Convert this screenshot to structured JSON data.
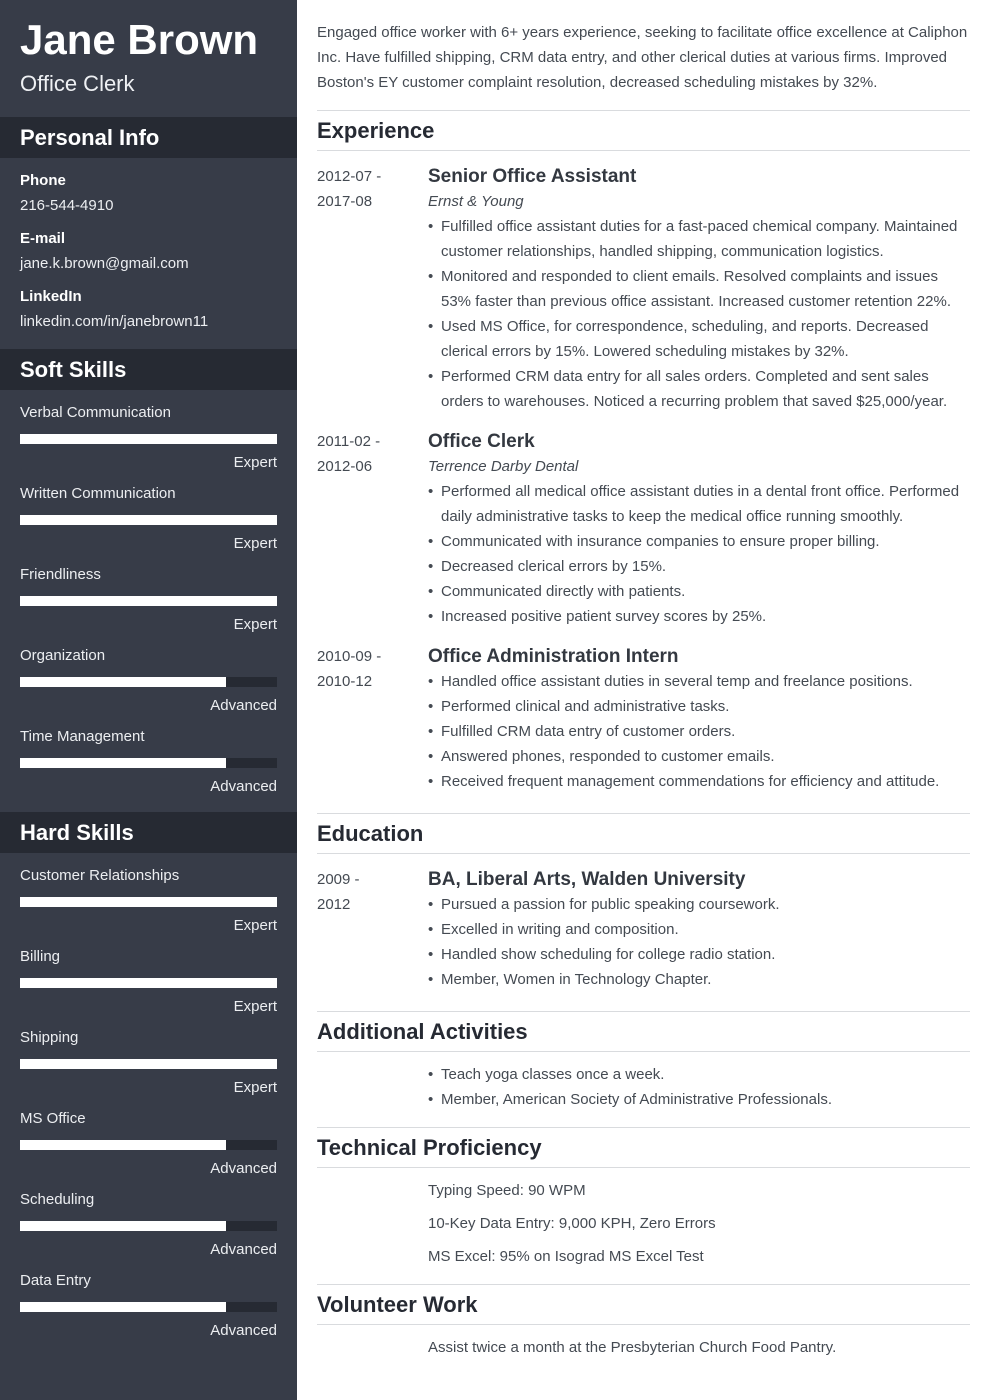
{
  "header": {
    "name": "Jane Brown",
    "title": "Office Clerk"
  },
  "colors": {
    "sidebar_bg": "#373c48",
    "sidebar_heading_bg": "#262a33",
    "bar_fill": "#ffffff",
    "bar_track": "#262a33",
    "divider": "#d9dbde"
  },
  "personal_info": {
    "heading": "Personal Info",
    "fields": [
      {
        "label": "Phone",
        "value": "216-544-4910"
      },
      {
        "label": "E-mail",
        "value": "jane.k.brown@gmail.com"
      },
      {
        "label": "LinkedIn",
        "value": "linkedin.com/in/janebrown11"
      }
    ]
  },
  "soft_skills": {
    "heading": "Soft Skills",
    "items": [
      {
        "name": "Verbal Communication",
        "level": "Expert",
        "fraction": 1.0
      },
      {
        "name": "Written Communication",
        "level": "Expert",
        "fraction": 1.0
      },
      {
        "name": "Friendliness",
        "level": "Expert",
        "fraction": 1.0
      },
      {
        "name": "Organization",
        "level": "Advanced",
        "fraction": 0.8
      },
      {
        "name": "Time Management",
        "level": "Advanced",
        "fraction": 0.8
      }
    ]
  },
  "hard_skills": {
    "heading": "Hard Skills",
    "items": [
      {
        "name": "Customer Relationships",
        "level": "Expert",
        "fraction": 1.0
      },
      {
        "name": "Billing",
        "level": "Expert",
        "fraction": 1.0
      },
      {
        "name": "Shipping",
        "level": "Expert",
        "fraction": 1.0
      },
      {
        "name": "MS Office",
        "level": "Advanced",
        "fraction": 0.8
      },
      {
        "name": "Scheduling",
        "level": "Advanced",
        "fraction": 0.8
      },
      {
        "name": "Data Entry",
        "level": "Advanced",
        "fraction": 0.8
      }
    ]
  },
  "summary": "Engaged office worker with 6+ years experience, seeking to facilitate office excellence at Caliphon Inc. Have fulfilled shipping, CRM data entry, and other clerical duties at various firms. Improved Boston's EY customer complaint resolution, decreased scheduling mistakes by 32%.",
  "experience": {
    "heading": "Experience",
    "entries": [
      {
        "date_start": "2012-07 -",
        "date_end": "2017-08",
        "title": "Senior Office Assistant",
        "company": "Ernst & Young",
        "bullets": [
          "Fulfilled office assistant duties for a fast-paced chemical company. Maintained customer relationships, handled shipping, communication logistics.",
          "Monitored and responded to client emails. Resolved complaints and issues 53% faster than previous office assistant. Increased customer retention 22%.",
          "Used MS Office, for correspondence, scheduling, and reports. Decreased clerical errors by 15%. Lowered scheduling mistakes by 32%.",
          "Performed CRM data entry for all sales orders. Completed and sent sales orders to warehouses. Noticed a recurring problem that saved $25,000/year."
        ]
      },
      {
        "date_start": "2011-02 -",
        "date_end": "2012-06",
        "title": "Office Clerk",
        "company": "Terrence Darby Dental",
        "bullets": [
          "Performed all medical office assistant duties in a dental front office. Performed daily administrative tasks to keep the medical office running smoothly.",
          "Communicated with insurance companies to ensure proper billing.",
          "Decreased clerical errors by 15%.",
          "Communicated directly with patients.",
          "Increased positive patient survey scores by 25%."
        ]
      },
      {
        "date_start": "2010-09 -",
        "date_end": "2010-12",
        "title": "Office Administration Intern",
        "company": "",
        "bullets": [
          "Handled office assistant duties in several temp and freelance positions.",
          "Performed clinical and administrative tasks.",
          "Fulfilled CRM data entry of customer orders.",
          "Answered phones, responded to customer emails.",
          "Received frequent management commendations for efficiency and attitude."
        ]
      }
    ]
  },
  "education": {
    "heading": "Education",
    "entries": [
      {
        "date_start": "2009 -",
        "date_end": "2012",
        "title": "BA, Liberal Arts, Walden University",
        "bullets": [
          "Pursued a passion for public speaking coursework.",
          "Excelled in writing and composition.",
          "Handled show scheduling for college radio station.",
          "Member, Women in Technology Chapter."
        ]
      }
    ]
  },
  "additional_activities": {
    "heading": "Additional Activities",
    "bullets": [
      "Teach yoga classes once a week.",
      "Member, American Society of Administrative Professionals."
    ]
  },
  "technical_proficiency": {
    "heading": "Technical Proficiency",
    "lines": [
      "Typing Speed: 90 WPM",
      "10-Key Data Entry: 9,000 KPH, Zero Errors",
      "MS Excel: 95% on Isograd MS Excel Test"
    ]
  },
  "volunteer_work": {
    "heading": "Volunteer Work",
    "lines": [
      "Assist twice a month at the Presbyterian Church Food Pantry."
    ]
  }
}
